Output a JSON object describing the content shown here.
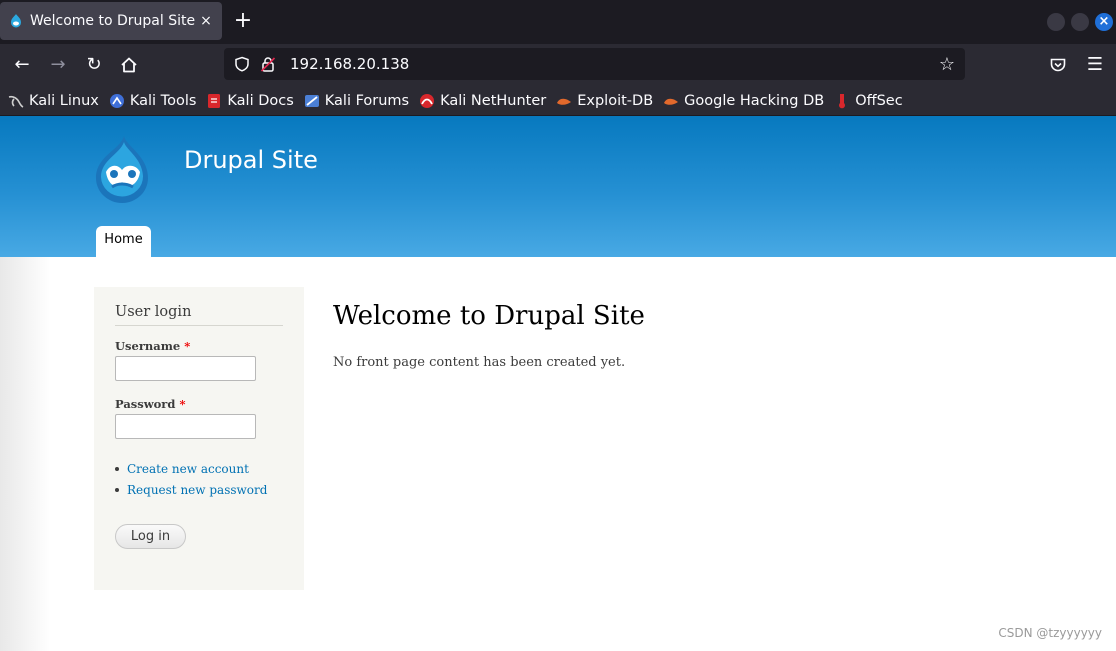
{
  "browser": {
    "tab": {
      "title": "Welcome to Drupal Site | D",
      "close": "×"
    },
    "new_tab": "+",
    "window_close": "×",
    "url": "192.168.20.138",
    "bookmarks": [
      {
        "label": "Kali Linux",
        "icon": "kali-dragon-icon",
        "color": "#cfcfcf"
      },
      {
        "label": "Kali Tools",
        "icon": "kali-tools-icon",
        "color": "#3f6fd8"
      },
      {
        "label": "Kali Docs",
        "icon": "kali-docs-icon",
        "color": "#d8272c"
      },
      {
        "label": "Kali Forums",
        "icon": "kali-forums-icon",
        "color": "#4b7fd6"
      },
      {
        "label": "Kali NetHunter",
        "icon": "kali-nethunter-icon",
        "color": "#d8272c"
      },
      {
        "label": "Exploit-DB",
        "icon": "exploit-db-icon",
        "color": "#e2692c"
      },
      {
        "label": "Google Hacking DB",
        "icon": "ghdb-icon",
        "color": "#e2692c"
      },
      {
        "label": "OffSec",
        "icon": "offsec-icon",
        "color": "#d8272c"
      }
    ]
  },
  "site": {
    "name": "Drupal Site",
    "nav": {
      "home": "Home"
    },
    "login_block": {
      "title": "User login",
      "username_label": "Username",
      "password_label": "Password",
      "required_mark": "*",
      "links": [
        "Create new account",
        "Request new password"
      ],
      "submit": "Log in"
    },
    "content": {
      "title": "Welcome to Drupal Site",
      "message": "No front page content has been created yet."
    }
  },
  "watermark": "CSDN @tzyyyyyy",
  "colors": {
    "header_top": "#0779bf",
    "header_bottom": "#48a9e4",
    "link": "#0071b3",
    "required": "#ee0000"
  }
}
